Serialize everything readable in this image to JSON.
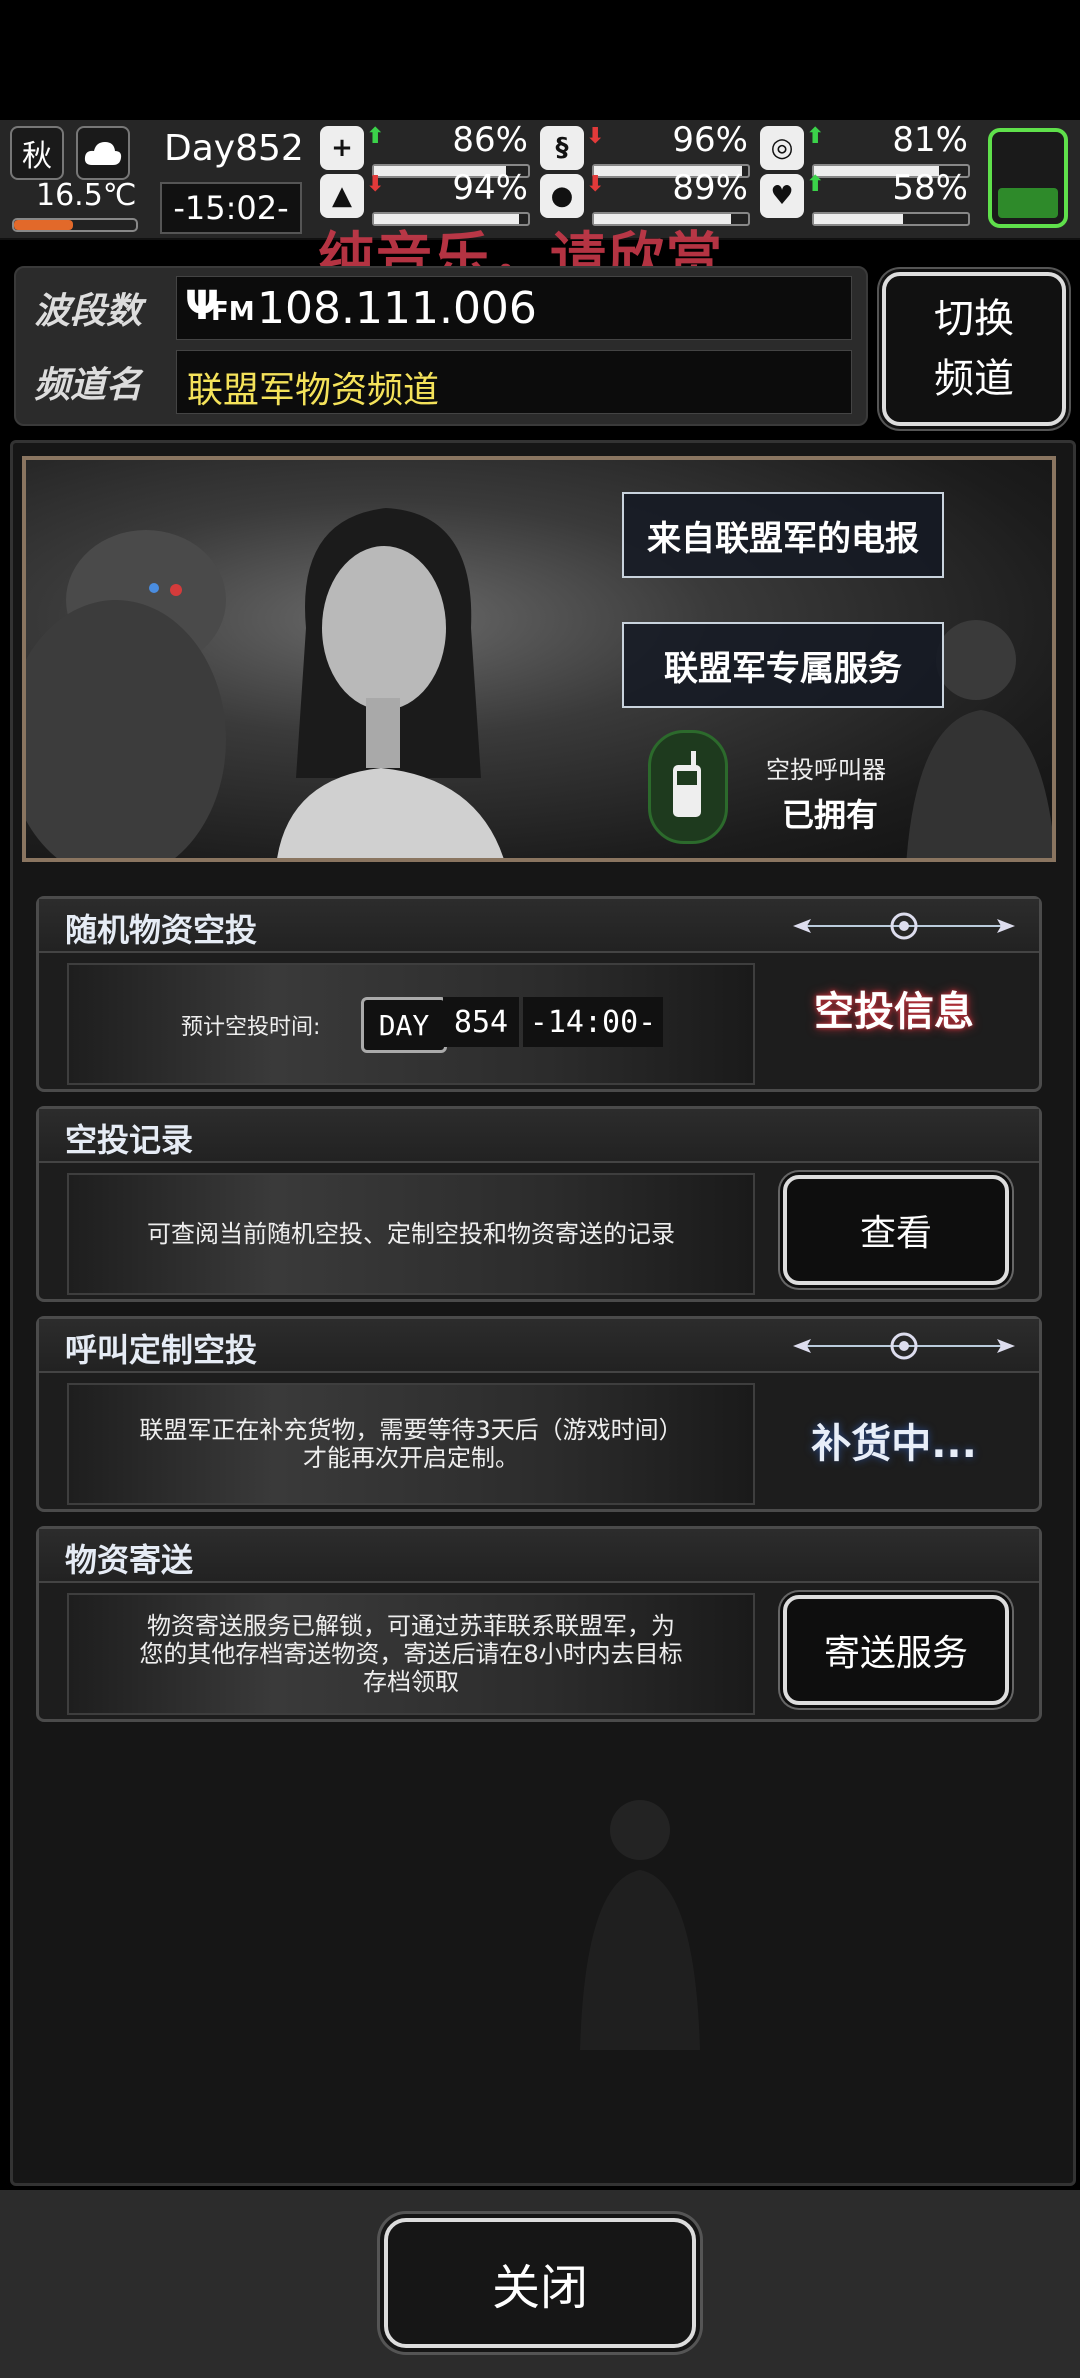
{
  "status": {
    "season": "秋",
    "temperature": "16.5℃",
    "day": "Day852",
    "time": "-15:02-",
    "stats": [
      {
        "name": "health",
        "icon": "medkit-icon",
        "glyph": "+",
        "trend": "up",
        "value": "86%",
        "level": 0.86
      },
      {
        "name": "hunger",
        "icon": "stomach-icon",
        "glyph": "§",
        "trend": "down",
        "value": "96%",
        "level": 0.96
      },
      {
        "name": "medicine",
        "icon": "pill-icon",
        "glyph": "◎",
        "trend": "up",
        "value": "81%",
        "level": 0.81
      },
      {
        "name": "stamina",
        "icon": "leg-icon",
        "glyph": "▲",
        "trend": "down",
        "value": "94%",
        "level": 0.94
      },
      {
        "name": "thirst",
        "icon": "water-drop-icon",
        "glyph": "●",
        "trend": "down",
        "value": "89%",
        "level": 0.89
      },
      {
        "name": "mood",
        "icon": "heart-icon",
        "glyph": "♥",
        "trend": "up",
        "value": "58%",
        "level": 0.58
      }
    ],
    "arrows": {
      "up": "⬆",
      "down": "⬇"
    }
  },
  "overlay_text": "纯音乐，请欣赏",
  "radio": {
    "frequency_label": "波段数",
    "frequency": "108.111.006",
    "fm_badge": "FM",
    "channel_label": "频道名",
    "channel": "联盟军物资频道",
    "switch_line1": "切换",
    "switch_line2": "频道"
  },
  "banner": {
    "button1": "来自联盟军的电报",
    "button2": "联盟军专属服务",
    "airdrop_caller_label": "空投呼叫器",
    "airdrop_caller_status": "已拥有"
  },
  "sections": {
    "random_airdrop": {
      "title": "随机物资空投",
      "expected_label": "预计空投时间:",
      "day_badge": "DAY",
      "day_value": "854",
      "time_value": "-14:00-",
      "action": "空投信息"
    },
    "airdrop_record": {
      "title": "空投记录",
      "desc": "可查阅当前随机空投、定制空投和物资寄送的记录",
      "action": "查看"
    },
    "custom_airdrop": {
      "title": "呼叫定制空投",
      "desc_line1": "联盟军正在补充货物，需要等待3天后（游戏时间）",
      "desc_line2": "才能再次开启定制。",
      "action": "补货中..."
    },
    "supply_delivery": {
      "title": "物资寄送",
      "desc_line1": "物资寄送服务已解锁，可通过苏菲联系联盟军，为",
      "desc_line2": "您的其他存档寄送物资，寄送后请在8小时内去目标",
      "desc_line3": "存档领取",
      "action": "寄送服务"
    }
  },
  "close_button": "关闭"
}
